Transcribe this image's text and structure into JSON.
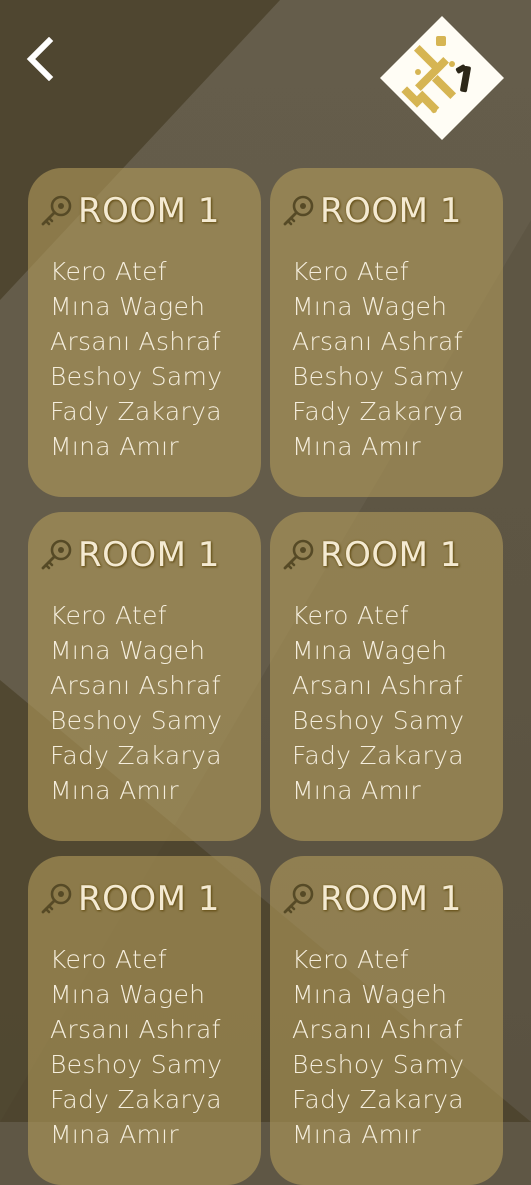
{
  "colors": {
    "card_background": "#b09a5a",
    "card_text": "#f5eedd",
    "logo_gold": "#d6b553",
    "logo_background": "#fffdf5",
    "background_dark": "#463d27",
    "background_mid": "#5f5745"
  },
  "header": {
    "back_icon": "chevron-left-icon",
    "logo_icon": "app-logo"
  },
  "rooms": [
    {
      "title": "ROOM 1",
      "icon": "key-icon",
      "members": [
        "Kero Atef",
        "Mına Wageh",
        "Arsanı Ashraf",
        "Beshoy Samy",
        "Fady Zakarya",
        "Mına Amır"
      ]
    },
    {
      "title": "ROOM 1",
      "icon": "key-icon",
      "members": [
        "Kero Atef",
        "Mına Wageh",
        "Arsanı Ashraf",
        "Beshoy Samy",
        "Fady Zakarya",
        "Mına Amır"
      ]
    },
    {
      "title": "ROOM 1",
      "icon": "key-icon",
      "members": [
        "Kero Atef",
        "Mına Wageh",
        "Arsanı Ashraf",
        "Beshoy Samy",
        "Fady Zakarya",
        "Mına Amır"
      ]
    },
    {
      "title": "ROOM 1",
      "icon": "key-icon",
      "members": [
        "Kero Atef",
        "Mına Wageh",
        "Arsanı Ashraf",
        "Beshoy Samy",
        "Fady Zakarya",
        "Mına Amır"
      ]
    },
    {
      "title": "ROOM 1",
      "icon": "key-icon",
      "members": [
        "Kero Atef",
        "Mına Wageh",
        "Arsanı Ashraf",
        "Beshoy Samy",
        "Fady Zakarya",
        "Mına Amır"
      ]
    },
    {
      "title": "ROOM 1",
      "icon": "key-icon",
      "members": [
        "Kero Atef",
        "Mına Wageh",
        "Arsanı Ashraf",
        "Beshoy Samy",
        "Fady Zakarya",
        "Mına Amır"
      ]
    }
  ]
}
